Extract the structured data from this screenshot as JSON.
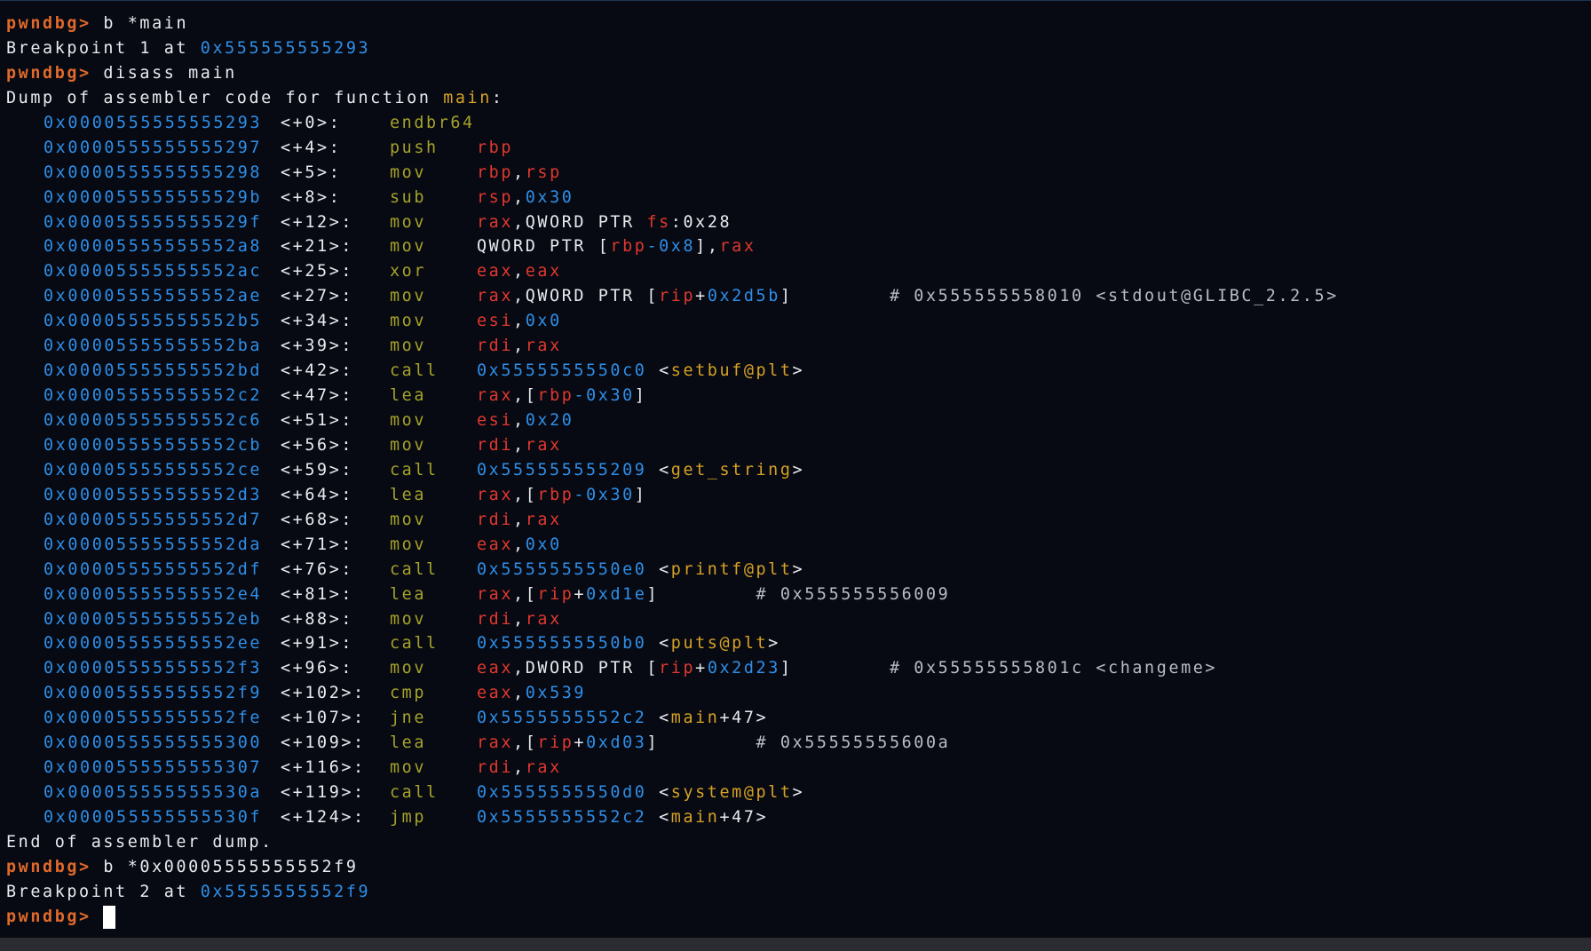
{
  "prompt": "pwndbg>",
  "session": {
    "cmd1": "b *main",
    "bp1_text": "Breakpoint 1 at ",
    "bp1_addr": "0x555555555293",
    "cmd2": "disass main",
    "dump_header_prefix": "Dump of assembler code for function ",
    "dump_header_func": "main",
    "dump_header_suffix": ":",
    "dump_footer": "End of assembler dump.",
    "cmd3": "b *0x00005555555552f9",
    "bp2_text": "Breakpoint 2 at ",
    "bp2_addr": "0x5555555552f9"
  },
  "asm": [
    {
      "addr": "0x0000555555555293",
      "off": "<+0>:",
      "mnem": "endbr64",
      "ops": []
    },
    {
      "addr": "0x0000555555555297",
      "off": "<+4>:",
      "mnem": "push",
      "ops": [
        {
          "t": "rbp",
          "c": "red"
        }
      ]
    },
    {
      "addr": "0x0000555555555298",
      "off": "<+5>:",
      "mnem": "mov",
      "ops": [
        {
          "t": "rbp",
          "c": "red"
        },
        {
          "t": ",",
          "c": "white"
        },
        {
          "t": "rsp",
          "c": "red"
        }
      ]
    },
    {
      "addr": "0x000055555555529b",
      "off": "<+8>:",
      "mnem": "sub",
      "ops": [
        {
          "t": "rsp",
          "c": "red"
        },
        {
          "t": ",",
          "c": "white"
        },
        {
          "t": "0x30",
          "c": "blue"
        }
      ]
    },
    {
      "addr": "0x000055555555529f",
      "off": "<+12>:",
      "mnem": "mov",
      "ops": [
        {
          "t": "rax",
          "c": "red"
        },
        {
          "t": ",QWORD PTR ",
          "c": "white"
        },
        {
          "t": "fs",
          "c": "red"
        },
        {
          "t": ":0x28",
          "c": "white"
        }
      ]
    },
    {
      "addr": "0x00005555555552a8",
      "off": "<+21>:",
      "mnem": "mov",
      "ops": [
        {
          "t": "QWORD PTR [",
          "c": "white"
        },
        {
          "t": "rbp",
          "c": "red"
        },
        {
          "t": "-0x8",
          "c": "blue"
        },
        {
          "t": "],",
          "c": "white"
        },
        {
          "t": "rax",
          "c": "red"
        }
      ]
    },
    {
      "addr": "0x00005555555552ac",
      "off": "<+25>:",
      "mnem": "xor",
      "ops": [
        {
          "t": "eax",
          "c": "red"
        },
        {
          "t": ",",
          "c": "white"
        },
        {
          "t": "eax",
          "c": "red"
        }
      ]
    },
    {
      "addr": "0x00005555555552ae",
      "off": "<+27>:",
      "mnem": "mov",
      "ops": [
        {
          "t": "rax",
          "c": "red"
        },
        {
          "t": ",QWORD PTR [",
          "c": "white"
        },
        {
          "t": "rip",
          "c": "red"
        },
        {
          "t": "+",
          "c": "white"
        },
        {
          "t": "0x2d5b",
          "c": "blue"
        },
        {
          "t": "]",
          "c": "white"
        },
        {
          "t": "        # 0x555555558010 <stdout@GLIBC_2.2.5>",
          "c": "gray"
        }
      ]
    },
    {
      "addr": "0x00005555555552b5",
      "off": "<+34>:",
      "mnem": "mov",
      "ops": [
        {
          "t": "esi",
          "c": "red"
        },
        {
          "t": ",",
          "c": "white"
        },
        {
          "t": "0x0",
          "c": "blue"
        }
      ]
    },
    {
      "addr": "0x00005555555552ba",
      "off": "<+39>:",
      "mnem": "mov",
      "ops": [
        {
          "t": "rdi",
          "c": "red"
        },
        {
          "t": ",",
          "c": "white"
        },
        {
          "t": "rax",
          "c": "red"
        }
      ]
    },
    {
      "addr": "0x00005555555552bd",
      "off": "<+42>:",
      "mnem": "call",
      "ops": [
        {
          "t": "0x5555555550c0",
          "c": "blue"
        },
        {
          "t": " <",
          "c": "white"
        },
        {
          "t": "setbuf@plt",
          "c": "yellow"
        },
        {
          "t": ">",
          "c": "white"
        }
      ]
    },
    {
      "addr": "0x00005555555552c2",
      "off": "<+47>:",
      "mnem": "lea",
      "ops": [
        {
          "t": "rax",
          "c": "red"
        },
        {
          "t": ",[",
          "c": "white"
        },
        {
          "t": "rbp",
          "c": "red"
        },
        {
          "t": "-0x30",
          "c": "blue"
        },
        {
          "t": "]",
          "c": "white"
        }
      ]
    },
    {
      "addr": "0x00005555555552c6",
      "off": "<+51>:",
      "mnem": "mov",
      "ops": [
        {
          "t": "esi",
          "c": "red"
        },
        {
          "t": ",",
          "c": "white"
        },
        {
          "t": "0x20",
          "c": "blue"
        }
      ]
    },
    {
      "addr": "0x00005555555552cb",
      "off": "<+56>:",
      "mnem": "mov",
      "ops": [
        {
          "t": "rdi",
          "c": "red"
        },
        {
          "t": ",",
          "c": "white"
        },
        {
          "t": "rax",
          "c": "red"
        }
      ]
    },
    {
      "addr": "0x00005555555552ce",
      "off": "<+59>:",
      "mnem": "call",
      "ops": [
        {
          "t": "0x555555555209",
          "c": "blue"
        },
        {
          "t": " <",
          "c": "white"
        },
        {
          "t": "get_string",
          "c": "yellow"
        },
        {
          "t": ">",
          "c": "white"
        }
      ]
    },
    {
      "addr": "0x00005555555552d3",
      "off": "<+64>:",
      "mnem": "lea",
      "ops": [
        {
          "t": "rax",
          "c": "red"
        },
        {
          "t": ",[",
          "c": "white"
        },
        {
          "t": "rbp",
          "c": "red"
        },
        {
          "t": "-0x30",
          "c": "blue"
        },
        {
          "t": "]",
          "c": "white"
        }
      ]
    },
    {
      "addr": "0x00005555555552d7",
      "off": "<+68>:",
      "mnem": "mov",
      "ops": [
        {
          "t": "rdi",
          "c": "red"
        },
        {
          "t": ",",
          "c": "white"
        },
        {
          "t": "rax",
          "c": "red"
        }
      ]
    },
    {
      "addr": "0x00005555555552da",
      "off": "<+71>:",
      "mnem": "mov",
      "ops": [
        {
          "t": "eax",
          "c": "red"
        },
        {
          "t": ",",
          "c": "white"
        },
        {
          "t": "0x0",
          "c": "blue"
        }
      ]
    },
    {
      "addr": "0x00005555555552df",
      "off": "<+76>:",
      "mnem": "call",
      "ops": [
        {
          "t": "0x5555555550e0",
          "c": "blue"
        },
        {
          "t": " <",
          "c": "white"
        },
        {
          "t": "printf@plt",
          "c": "yellow"
        },
        {
          "t": ">",
          "c": "white"
        }
      ]
    },
    {
      "addr": "0x00005555555552e4",
      "off": "<+81>:",
      "mnem": "lea",
      "ops": [
        {
          "t": "rax",
          "c": "red"
        },
        {
          "t": ",[",
          "c": "white"
        },
        {
          "t": "rip",
          "c": "red"
        },
        {
          "t": "+",
          "c": "white"
        },
        {
          "t": "0xd1e",
          "c": "blue"
        },
        {
          "t": "]",
          "c": "white"
        },
        {
          "t": "        # 0x555555556009",
          "c": "gray"
        }
      ]
    },
    {
      "addr": "0x00005555555552eb",
      "off": "<+88>:",
      "mnem": "mov",
      "ops": [
        {
          "t": "rdi",
          "c": "red"
        },
        {
          "t": ",",
          "c": "white"
        },
        {
          "t": "rax",
          "c": "red"
        }
      ]
    },
    {
      "addr": "0x00005555555552ee",
      "off": "<+91>:",
      "mnem": "call",
      "ops": [
        {
          "t": "0x5555555550b0",
          "c": "blue"
        },
        {
          "t": " <",
          "c": "white"
        },
        {
          "t": "puts@plt",
          "c": "yellow"
        },
        {
          "t": ">",
          "c": "white"
        }
      ]
    },
    {
      "addr": "0x00005555555552f3",
      "off": "<+96>:",
      "mnem": "mov",
      "ops": [
        {
          "t": "eax",
          "c": "red"
        },
        {
          "t": ",DWORD PTR [",
          "c": "white"
        },
        {
          "t": "rip",
          "c": "red"
        },
        {
          "t": "+",
          "c": "white"
        },
        {
          "t": "0x2d23",
          "c": "blue"
        },
        {
          "t": "]",
          "c": "white"
        },
        {
          "t": "        # 0x55555555801c <changeme>",
          "c": "gray"
        }
      ]
    },
    {
      "addr": "0x00005555555552f9",
      "off": "<+102>:",
      "mnem": "cmp",
      "ops": [
        {
          "t": "eax",
          "c": "red"
        },
        {
          "t": ",",
          "c": "white"
        },
        {
          "t": "0x539",
          "c": "blue"
        }
      ]
    },
    {
      "addr": "0x00005555555552fe",
      "off": "<+107>:",
      "mnem": "jne",
      "ops": [
        {
          "t": "0x5555555552c2",
          "c": "blue"
        },
        {
          "t": " <",
          "c": "white"
        },
        {
          "t": "main",
          "c": "yellow"
        },
        {
          "t": "+47>",
          "c": "white"
        }
      ]
    },
    {
      "addr": "0x0000555555555300",
      "off": "<+109>:",
      "mnem": "lea",
      "ops": [
        {
          "t": "rax",
          "c": "red"
        },
        {
          "t": ",[",
          "c": "white"
        },
        {
          "t": "rip",
          "c": "red"
        },
        {
          "t": "+",
          "c": "white"
        },
        {
          "t": "0xd03",
          "c": "blue"
        },
        {
          "t": "]",
          "c": "white"
        },
        {
          "t": "        # 0x55555555600a",
          "c": "gray"
        }
      ]
    },
    {
      "addr": "0x0000555555555307",
      "off": "<+116>:",
      "mnem": "mov",
      "ops": [
        {
          "t": "rdi",
          "c": "red"
        },
        {
          "t": ",",
          "c": "white"
        },
        {
          "t": "rax",
          "c": "red"
        }
      ]
    },
    {
      "addr": "0x000055555555530a",
      "off": "<+119>:",
      "mnem": "call",
      "ops": [
        {
          "t": "0x5555555550d0",
          "c": "blue"
        },
        {
          "t": " <",
          "c": "white"
        },
        {
          "t": "system@plt",
          "c": "yellow"
        },
        {
          "t": ">",
          "c": "white"
        }
      ]
    },
    {
      "addr": "0x000055555555530f",
      "off": "<+124>:",
      "mnem": "jmp",
      "ops": [
        {
          "t": "0x5555555552c2",
          "c": "blue"
        },
        {
          "t": " <",
          "c": "white"
        },
        {
          "t": "main",
          "c": "yellow"
        },
        {
          "t": "+47>",
          "c": "white"
        }
      ]
    }
  ],
  "colors": {
    "prompt": "#e0692b",
    "address": "#2f8ee8",
    "symbol": "#d7a126",
    "register": "#e1382f",
    "mnemonic": "#a5a22a",
    "text": "#e8ebef",
    "background": "#070a12"
  }
}
